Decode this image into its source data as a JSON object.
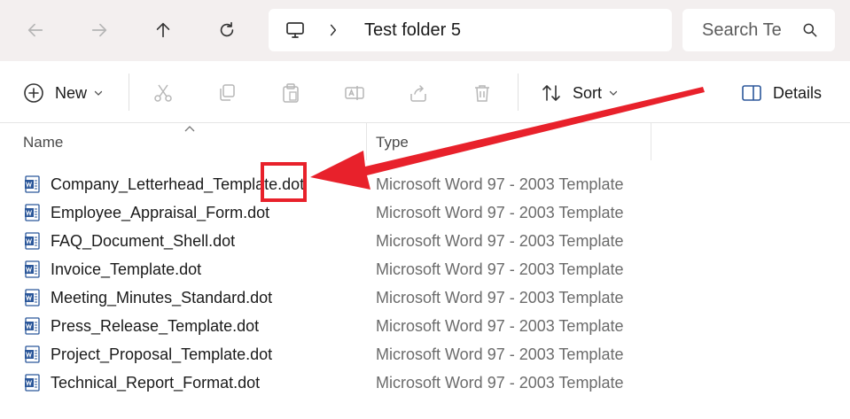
{
  "address": {
    "breadcrumb": "Test folder 5",
    "search_placeholder": "Search Te"
  },
  "toolbar": {
    "new_label": "New",
    "sort_label": "Sort",
    "details_label": "Details"
  },
  "columns": {
    "name": "Name",
    "type": "Type"
  },
  "files": [
    {
      "name": "Company_Letterhead_Template.dot",
      "type": "Microsoft Word 97 - 2003 Template"
    },
    {
      "name": "Employee_Appraisal_Form.dot",
      "type": "Microsoft Word 97 - 2003 Template"
    },
    {
      "name": "FAQ_Document_Shell.dot",
      "type": "Microsoft Word 97 - 2003 Template"
    },
    {
      "name": "Invoice_Template.dot",
      "type": "Microsoft Word 97 - 2003 Template"
    },
    {
      "name": "Meeting_Minutes_Standard.dot",
      "type": "Microsoft Word 97 - 2003 Template"
    },
    {
      "name": "Press_Release_Template.dot",
      "type": "Microsoft Word 97 - 2003 Template"
    },
    {
      "name": "Project_Proposal_Template.dot",
      "type": "Microsoft Word 97 - 2003 Template"
    },
    {
      "name": "Technical_Report_Format.dot",
      "type": "Microsoft Word 97 - 2003 Template"
    }
  ],
  "colors": {
    "annotation": "#e8212b",
    "word_blue": "#2b579a"
  }
}
